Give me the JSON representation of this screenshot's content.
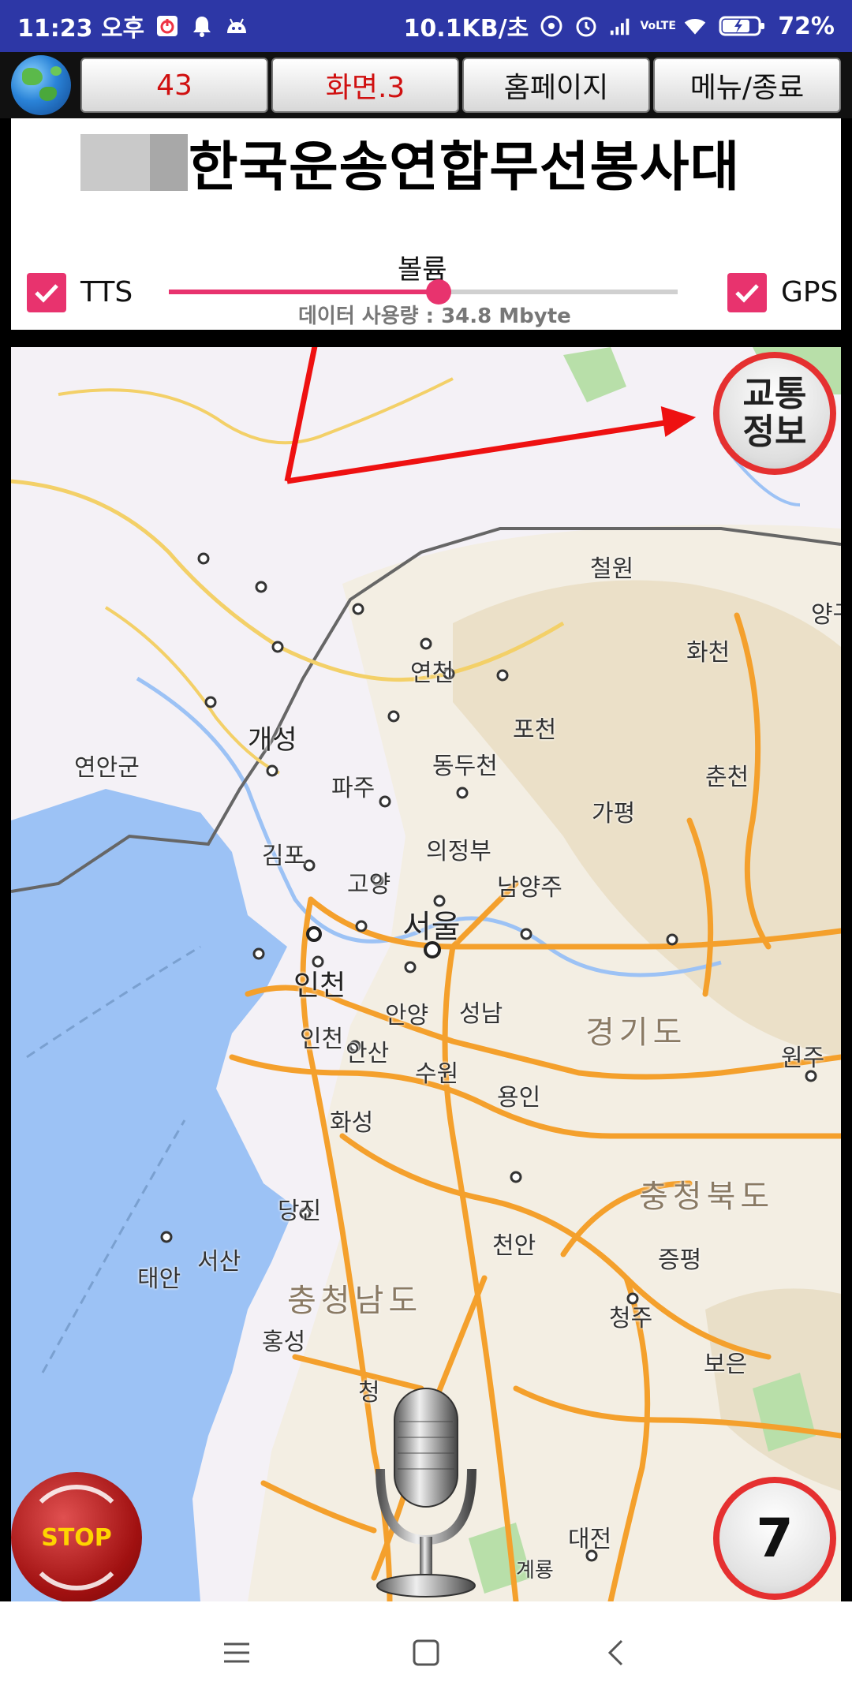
{
  "status_bar": {
    "time": "11:23 오후",
    "network_speed": "10.1KB/초",
    "battery": "72%",
    "icons": [
      "power-icon",
      "notification-bell-icon",
      "android-icon",
      "hotspot-icon",
      "alarm-icon",
      "signal-icon",
      "volte-icon",
      "wifi-icon",
      "battery-icon"
    ]
  },
  "toolbar": {
    "count": "43",
    "screen": "화면.3",
    "homepage": "홈페이지",
    "menu_exit": "메뉴/종료"
  },
  "header": {
    "title": "한국운송연합무선봉사대"
  },
  "controls": {
    "tts_label": "TTS",
    "tts_checked": true,
    "gps_label": "GPS",
    "gps_checked": true,
    "volume_label": "볼륨",
    "volume_fraction": 0.53,
    "data_usage": "데이터 사용량 : 34.8 Mbyte"
  },
  "map": {
    "traffic_button": [
      "교통",
      "정보"
    ],
    "labels": {
      "cheorwon": "철원",
      "yang": "양구",
      "hwacheon": "화천",
      "yeoncheon": "연천",
      "pocheon": "포천",
      "dongducheon": "동두천",
      "chuncheon": "춘천",
      "gaeseong": "개성",
      "yeonan": "연안군",
      "paju": "파주",
      "gapyeong": "가평",
      "gimpo": "김포",
      "uijeongbu": "의정부",
      "goyang": "고양",
      "namyangju": "남양주",
      "seoul": "서울",
      "incheon_big": "인천",
      "incheon": "인천",
      "anyang": "안양",
      "seongnam": "성남",
      "gyeonggi": "경기도",
      "wonju": "원주",
      "ansan": "안산",
      "suwon": "수원",
      "yongin": "용인",
      "hwaseong": "화성",
      "chungbuk": "충청북도",
      "dangjin": "당진",
      "seosan": "서산",
      "taean": "태안",
      "cheonan": "천안",
      "jeungpyeong": "증평",
      "chungnam": "충청남도",
      "cheongju": "청주",
      "hongseong": "홍성",
      "cheong": "청",
      "boeun": "보은",
      "daejeon": "대전",
      "gyeryong": "계룡"
    },
    "stop_label": "STOP",
    "count_badge": "7"
  },
  "colors": {
    "status_bar": "#2d37a6",
    "accent": "#e8336e",
    "red_ring": "#e53030",
    "highway": "#f4a02c",
    "water": "#9cc2f5"
  },
  "navbar": {
    "icons": [
      "menu-icon",
      "home-icon",
      "back-icon"
    ]
  }
}
